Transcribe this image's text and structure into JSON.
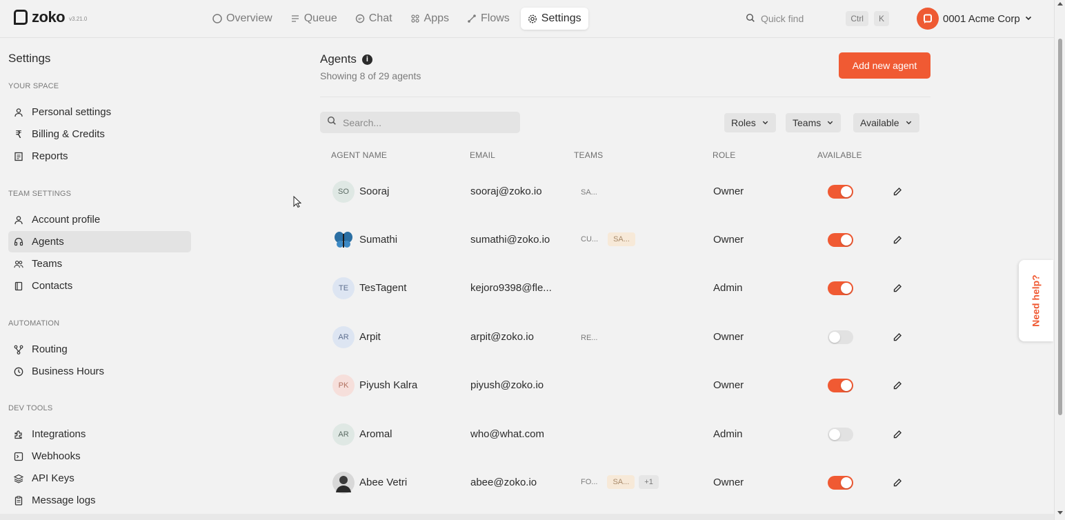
{
  "brand": {
    "name": "zoko",
    "version": "v3.21.0"
  },
  "nav": [
    {
      "label": "Overview",
      "icon": "circle-icon"
    },
    {
      "label": "Queue",
      "icon": "queue-icon"
    },
    {
      "label": "Chat",
      "icon": "chat-icon"
    },
    {
      "label": "Apps",
      "icon": "apps-icon"
    },
    {
      "label": "Flows",
      "icon": "flows-icon"
    },
    {
      "label": "Settings",
      "icon": "gear-icon",
      "active": true
    }
  ],
  "quickfind": {
    "label": "Quick find",
    "kbd1": "Ctrl",
    "kbd2": "K"
  },
  "account": {
    "name": "0001 Acme Corp"
  },
  "sidebar": {
    "title": "Settings",
    "your_space": "YOUR SPACE",
    "team_settings": "TEAM SETTINGS",
    "automation": "AUTOMATION",
    "dev_tools": "DEV TOOLS",
    "items": {
      "personal": "Personal settings",
      "billing": "Billing & Credits",
      "reports": "Reports",
      "account_profile": "Account profile",
      "agents": "Agents",
      "teams": "Teams",
      "contacts": "Contacts",
      "routing": "Routing",
      "business_hours": "Business Hours",
      "integrations": "Integrations",
      "webhooks": "Webhooks",
      "api_keys": "API Keys",
      "message_logs": "Message logs"
    }
  },
  "main": {
    "title": "Agents",
    "subtitle": "Showing 8 of 29 agents",
    "add_button": "Add new agent",
    "search_placeholder": "Search...",
    "filters": {
      "roles": "Roles",
      "teams": "Teams",
      "available": "Available"
    },
    "columns": {
      "name": "AGENT NAME",
      "email": "EMAIL",
      "teams": "TEAMS",
      "role": "ROLE",
      "available": "AVAILABLE"
    }
  },
  "agents": [
    {
      "initials": "SO",
      "name": "Sooraj",
      "email": "sooraj@zoko.io",
      "teams": [
        "SA..."
      ],
      "role": "Owner",
      "available": true
    },
    {
      "initials": "",
      "name": "Sumathi",
      "email": "sumathi@zoko.io",
      "teams": [
        "CU...",
        "SA..."
      ],
      "role": "Owner",
      "available": true
    },
    {
      "initials": "TE",
      "name": "TesTagent",
      "email": "kejoro9398@fle...",
      "teams": [],
      "role": "Admin",
      "available": true
    },
    {
      "initials": "AR",
      "name": "Arpit",
      "email": "arpit@zoko.io",
      "teams": [
        "RE..."
      ],
      "role": "Owner",
      "available": false
    },
    {
      "initials": "PK",
      "name": "Piyush Kalra",
      "email": "piyush@zoko.io",
      "teams": [],
      "role": "Owner",
      "available": true
    },
    {
      "initials": "AR",
      "name": "Aromal",
      "email": "who@what.com",
      "teams": [],
      "role": "Admin",
      "available": false
    },
    {
      "initials": "",
      "name": "Abee Vetri",
      "email": "abee@zoko.io",
      "teams": [
        "FO...",
        "SA...",
        "+1"
      ],
      "role": "Owner",
      "available": true
    }
  ],
  "help": {
    "label": "Need help?"
  },
  "colors": {
    "accent": "#f05a33",
    "background": "#f2f2f2"
  }
}
